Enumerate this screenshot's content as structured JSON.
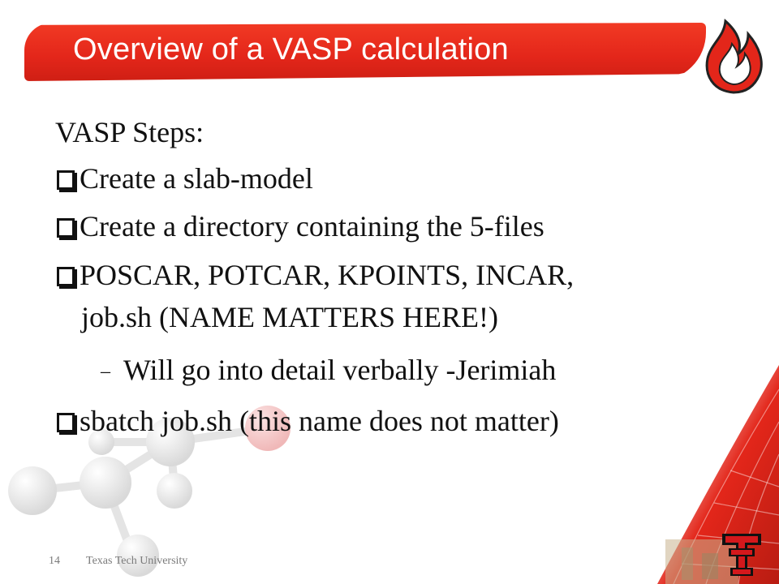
{
  "slide": {
    "title": "Overview of a VASP calculation",
    "heading": "VASP Steps:",
    "bullets": [
      "Create a slab-model",
      "Create a directory containing the 5-files",
      "POSCAR, POTCAR, KPOINTS, INCAR,",
      "job.sh (NAME MATTERS HERE!)",
      "Will go into detail verbally -Jerimiah",
      "sbatch job.sh (this name does not matter)"
    ]
  },
  "footer": {
    "page_number": "14",
    "organization": "Texas Tech University"
  },
  "colors": {
    "banner_red": "#e3261a",
    "text": "#111111",
    "footer_gray": "#7a7a7a"
  }
}
